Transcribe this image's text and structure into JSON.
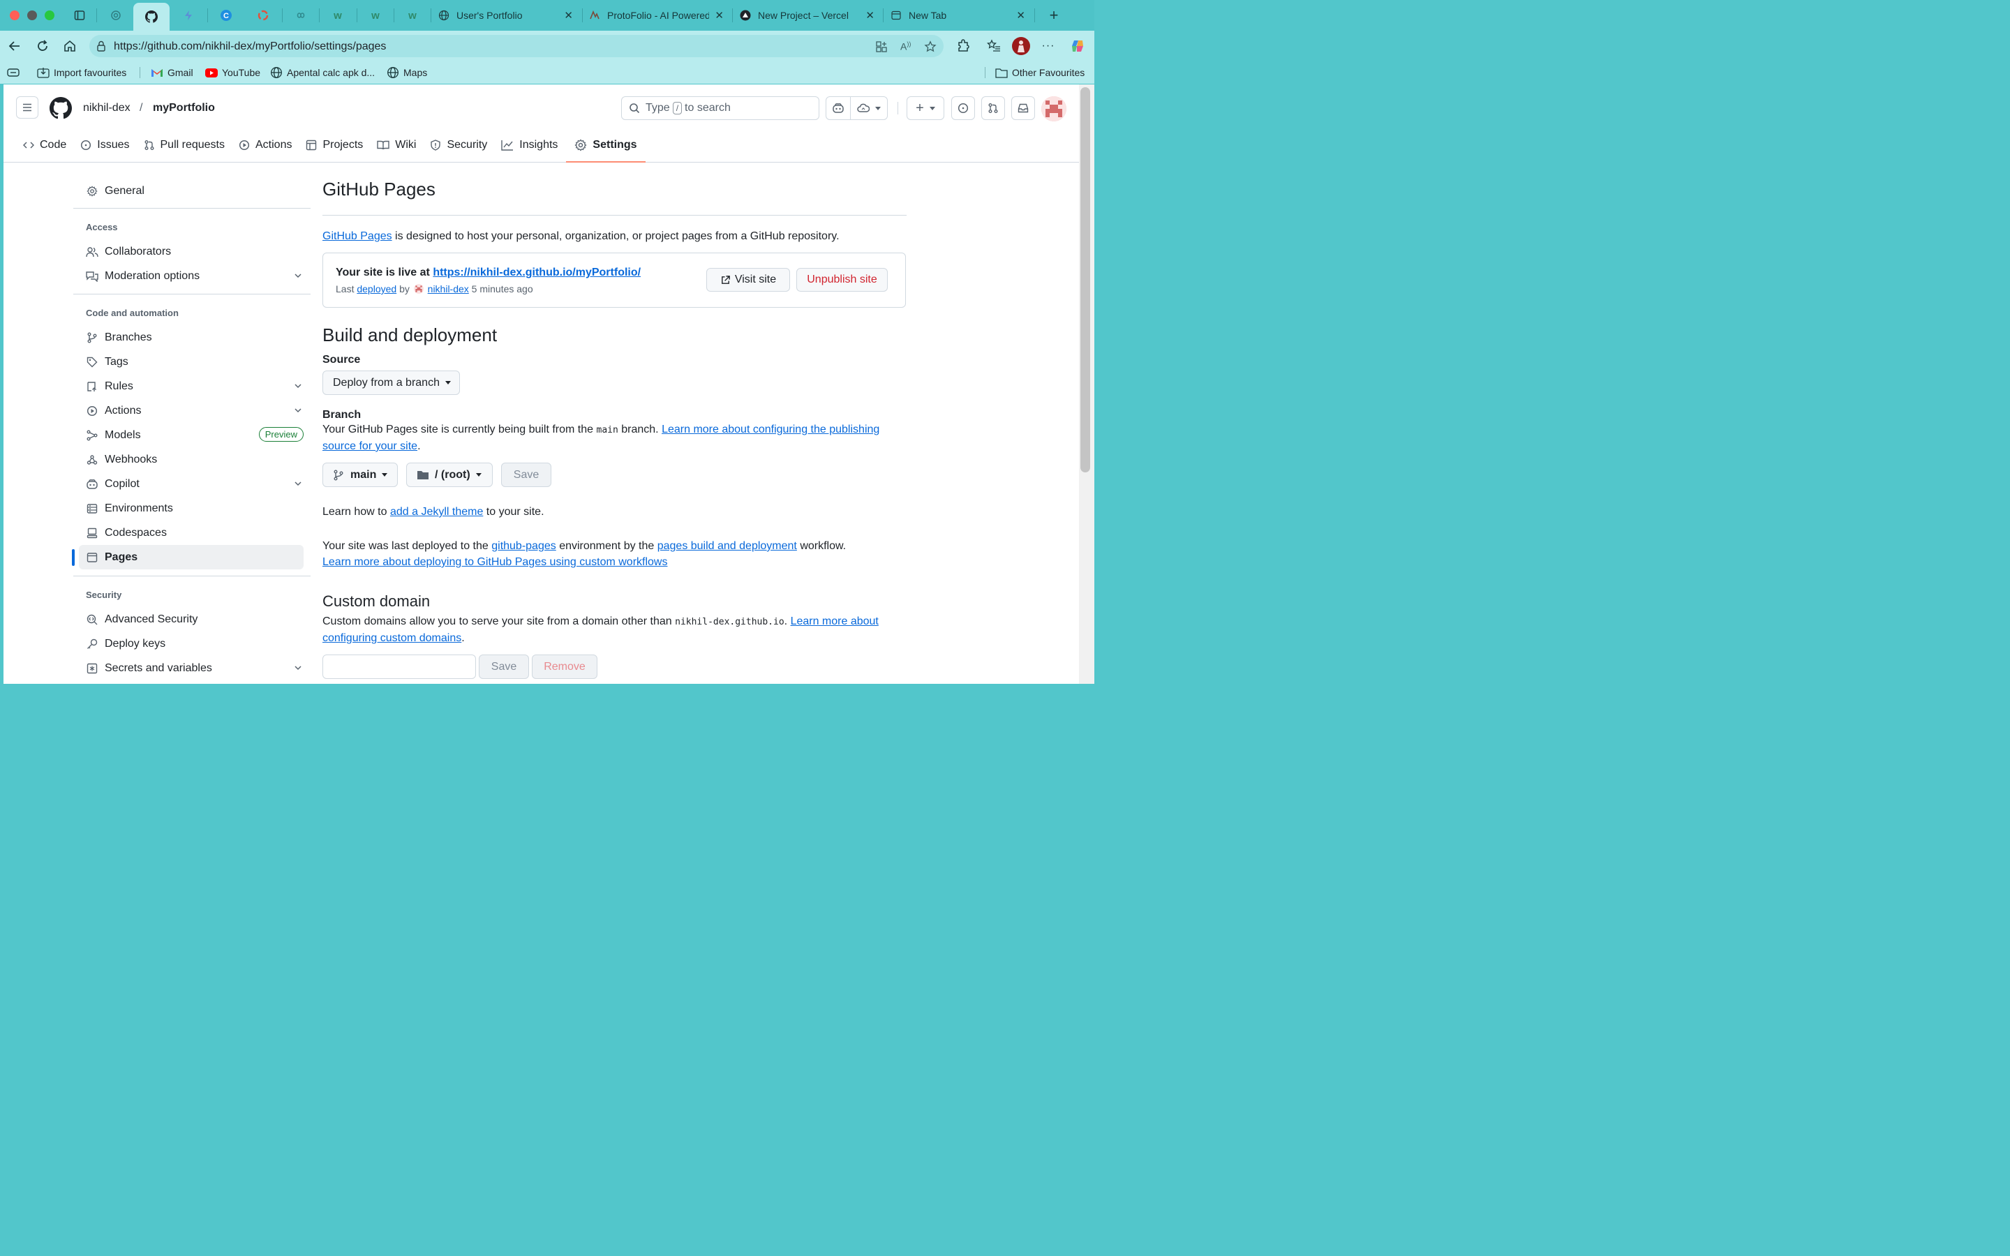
{
  "browser": {
    "tabs": [
      {
        "label": "User's Portfolio",
        "icon": "globe-icon"
      },
      {
        "label": "ProtoFolio - AI Powered",
        "icon": "protofolio-icon"
      },
      {
        "label": "New Project – Vercel",
        "icon": "vercel-icon"
      },
      {
        "label": "New Tab",
        "icon": "page-icon"
      }
    ],
    "url": "https://github.com/nikhil-dex/myPortfolio/settings/pages",
    "bookmarks": {
      "import": "Import favourites",
      "gmail": "Gmail",
      "youtube": "YouTube",
      "apental": "Apental calc apk d...",
      "maps": "Maps",
      "other": "Other Favourites"
    }
  },
  "github": {
    "owner": "nikhil-dex",
    "slash": "/",
    "repo": "myPortfolio",
    "search": {
      "prefix": "Type",
      "key": "/",
      "suffix": "to search"
    },
    "tabs": {
      "code": "Code",
      "issues": "Issues",
      "pulls": "Pull requests",
      "actions": "Actions",
      "projects": "Projects",
      "wiki": "Wiki",
      "security": "Security",
      "insights": "Insights",
      "settings": "Settings"
    }
  },
  "sidebar": {
    "general": "General",
    "access_heading": "Access",
    "collaborators": "Collaborators",
    "moderation": "Moderation options",
    "code_heading": "Code and automation",
    "branches": "Branches",
    "tags": "Tags",
    "rules": "Rules",
    "actions": "Actions",
    "models": "Models",
    "models_badge": "Preview",
    "webhooks": "Webhooks",
    "copilot": "Copilot",
    "environments": "Environments",
    "codespaces": "Codespaces",
    "pages": "Pages",
    "security_heading": "Security",
    "advanced_security": "Advanced Security",
    "deploy_keys": "Deploy keys",
    "secrets": "Secrets and variables"
  },
  "main": {
    "title": "GitHub Pages",
    "intro_link": "GitHub Pages",
    "intro_text": " is designed to host your personal, organization, or project pages from a GitHub repository.",
    "live": {
      "prefix": "Your site is live at ",
      "url": "https://nikhil-dex.github.io/myPortfolio/",
      "last": "Last ",
      "deployed": "deployed",
      "by": " by ",
      "user": "nikhil-dex",
      "ago": " 5 minutes ago",
      "visit": "Visit site",
      "unpublish": "Unpublish site"
    },
    "build_title": "Build and deployment",
    "source_label": "Source",
    "source_value": "Deploy from a branch",
    "branch_label": "Branch",
    "branch_text1": "Your GitHub Pages site is currently being built from the ",
    "branch_code": "main",
    "branch_text2": " branch. ",
    "branch_link": "Learn more about configuring the publishing source for your site",
    "branch_end": ".",
    "branch_value": "main",
    "folder_value": "/ (root)",
    "save": "Save",
    "jekyll_text1": "Learn how to ",
    "jekyll_link": "add a Jekyll theme",
    "jekyll_text2": " to your site.",
    "deployed_text1": "Your site was last deployed to the ",
    "deployed_env": "github-pages",
    "deployed_text2": " environment by the ",
    "deployed_workflow": "pages build and deployment",
    "deployed_text3": " workflow.",
    "deployed_learn": "Learn more about deploying to GitHub Pages using custom workflows",
    "custom_title": "Custom domain",
    "custom_text1": "Custom domains allow you to serve your site from a domain other than ",
    "custom_code": "nikhil-dex.github.io",
    "custom_text2": ". ",
    "custom_link": "Learn more about configuring custom domains",
    "custom_end": ".",
    "custom_save": "Save",
    "custom_remove": "Remove"
  }
}
